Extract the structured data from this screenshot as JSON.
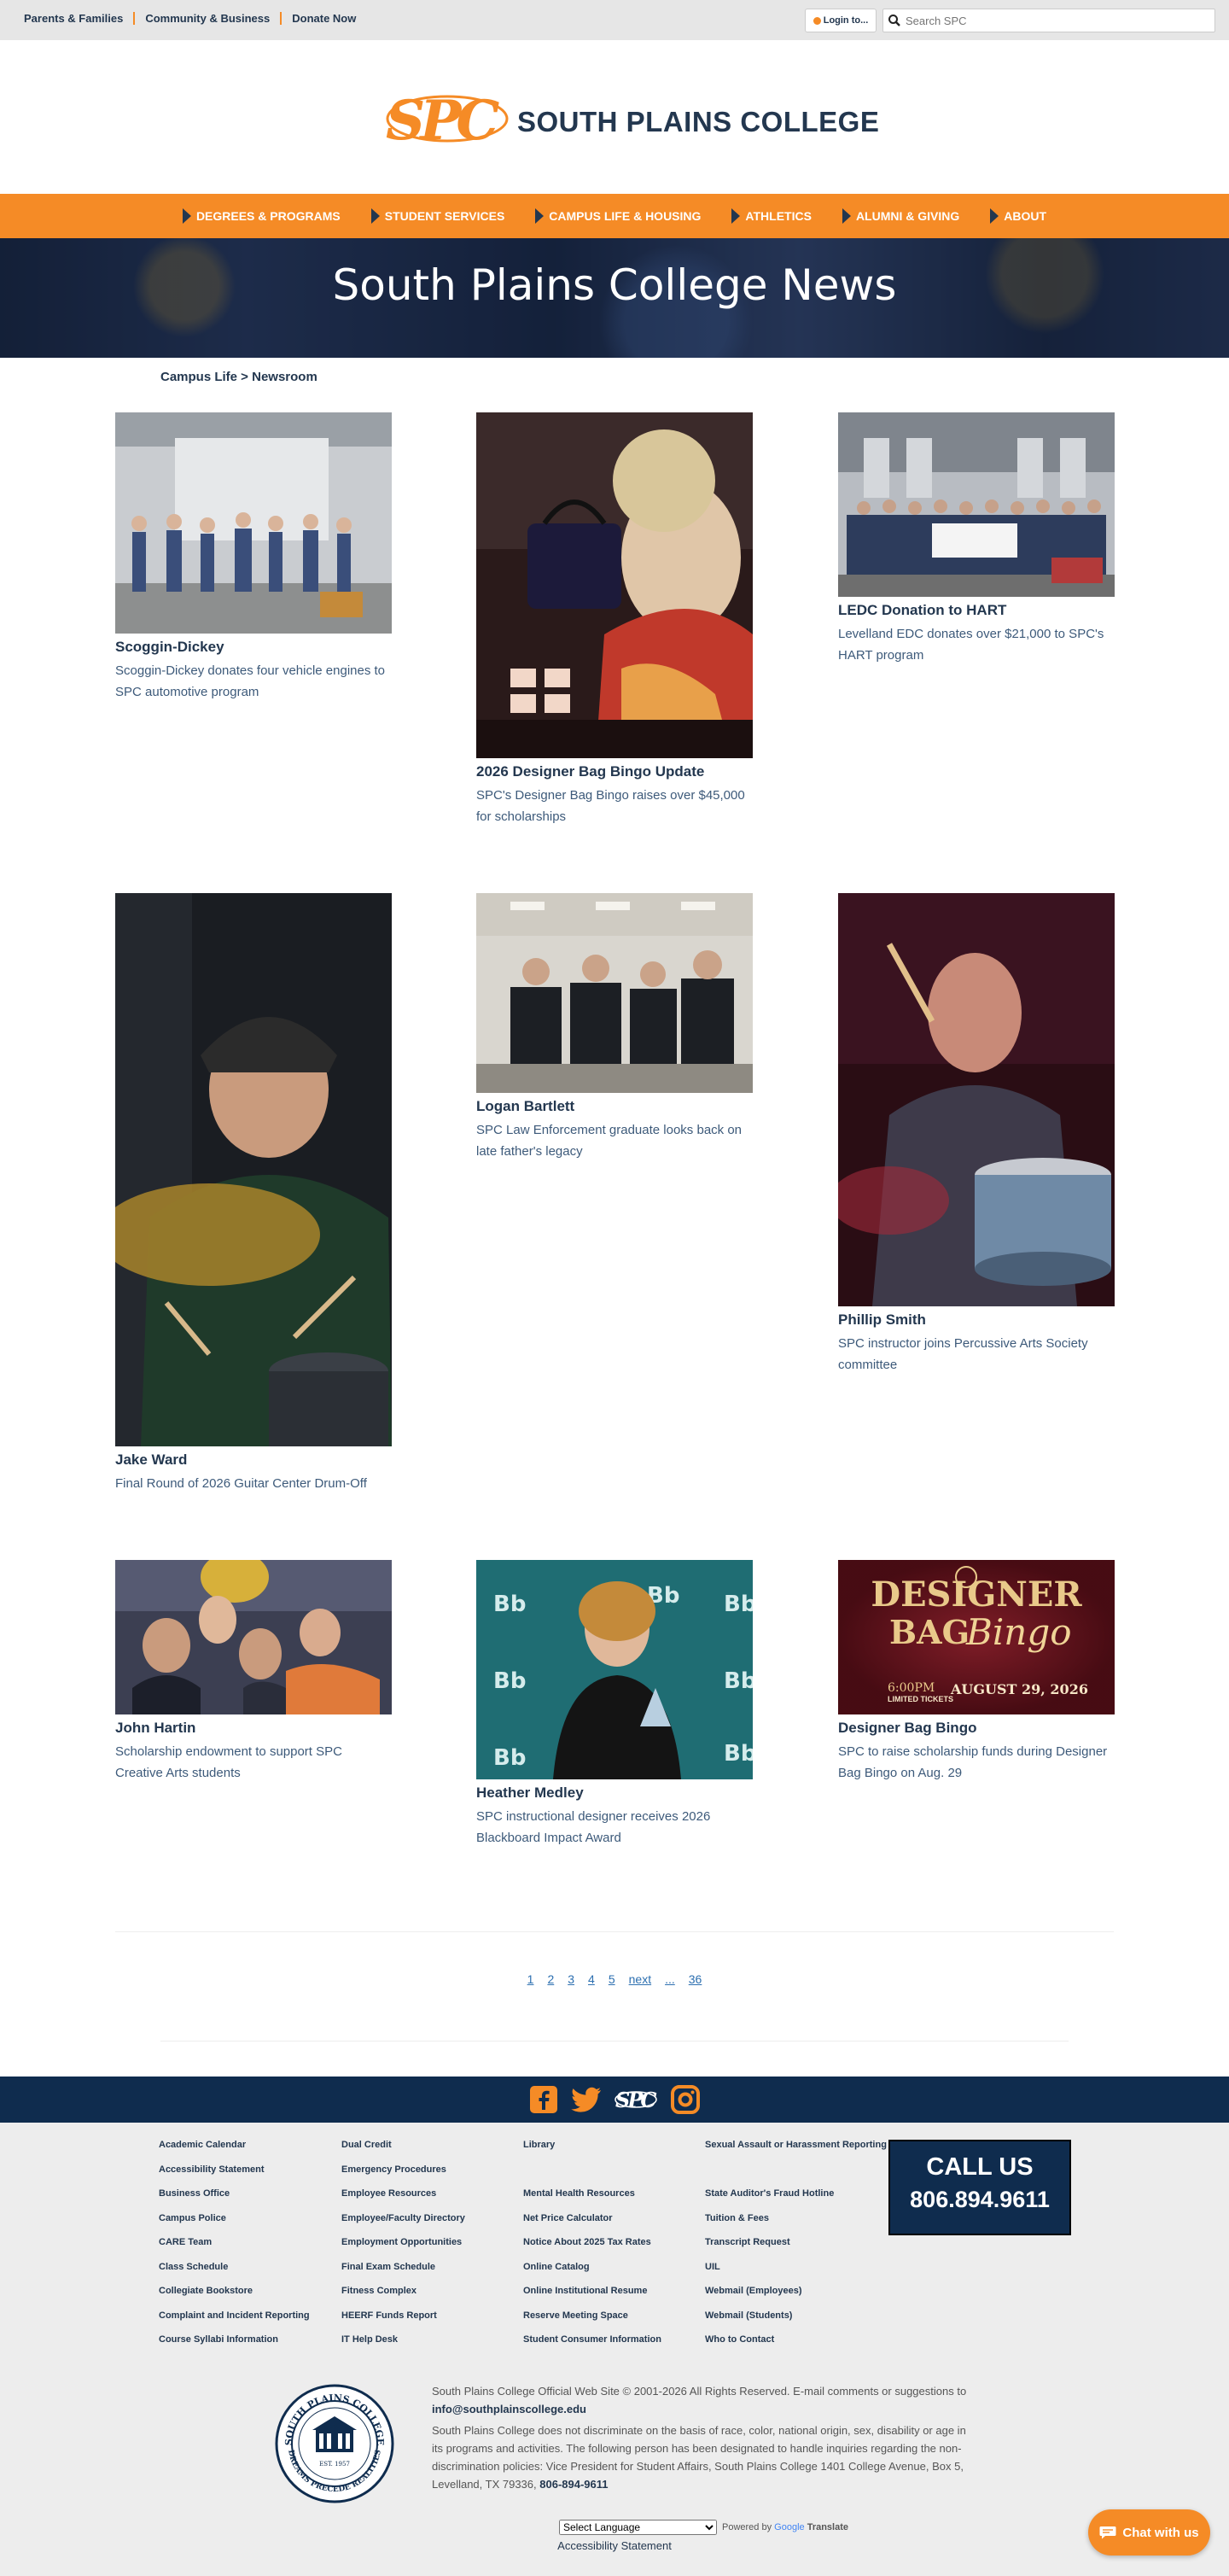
{
  "utility": {
    "links": [
      "Parents & Families",
      "Community & Business",
      "Donate Now"
    ],
    "login_label": "Login to...",
    "search_placeholder": "Search SPC"
  },
  "brand": {
    "logo_monogram": "SPC",
    "name": "SOUTH PLAINS COLLEGE",
    "primary_color": "#f58b26",
    "navy_color": "#23374f"
  },
  "nav": {
    "items": [
      "DEGREES & PROGRAMS",
      "STUDENT SERVICES",
      "CAMPUS LIFE & HOUSING",
      "ATHLETICS",
      "ALUMNI & GIVING",
      "ABOUT"
    ]
  },
  "hero": {
    "title": "South Plains College News"
  },
  "breadcrumb": "Campus Life > Newsroom",
  "news": [
    {
      "title": "Scoggin-Dickey",
      "desc": "Scoggin-Dickey donates four vehicle engines to SPC automotive program"
    },
    {
      "title": "2026 Designer Bag Bingo Update",
      "desc": "SPC's Designer Bag Bingo raises over $45,000 for scholarships"
    },
    {
      "title": "LEDC Donation to HART",
      "desc": "Levelland EDC donates over $21,000 to SPC's HART program"
    },
    {
      "title": "Jake Ward",
      "desc": "Final Round of 2026 Guitar Center Drum-Off"
    },
    {
      "title": "Logan Bartlett",
      "desc": "SPC Law Enforcement graduate looks back on late father's legacy"
    },
    {
      "title": "Phillip Smith",
      "desc": "SPC instructor joins Percussive Arts Society committee"
    },
    {
      "title": "John Hartin",
      "desc": "Scholarship endowment to support SPC Creative Arts students"
    },
    {
      "title": "Heather Medley",
      "desc": "SPC instructional designer receives 2026 Blackboard Impact Award"
    },
    {
      "title": "Designer Bag Bingo",
      "desc": "SPC to raise scholarship funds during Designer Bag Bingo on Aug. 29"
    }
  ],
  "bingo_banner": {
    "line1": "DESIGNER",
    "line2": "BAG",
    "line3": "Bingo",
    "time": "6:00PM",
    "date": "AUGUST 29, 2026",
    "limited": "LIMITED TICKETS"
  },
  "pagination": [
    "1",
    "2",
    "3",
    "4",
    "5",
    "next",
    "...",
    "36"
  ],
  "footer": {
    "col1": [
      "Academic Calendar",
      "Accessibility Statement",
      "Business Office",
      "Campus Police",
      "CARE Team",
      "Class Schedule",
      "Collegiate Bookstore",
      "Complaint and Incident Reporting",
      "Course Syllabi Information"
    ],
    "col2": [
      "Dual Credit",
      "Emergency Procedures",
      "Employee Resources",
      "Employee/Faculty Directory",
      "Employment Opportunities",
      "Final Exam Schedule",
      "Fitness Complex",
      "HEERF Funds Report",
      "IT Help Desk"
    ],
    "col3": [
      "Library",
      "",
      "Mental Health Resources",
      "Net Price Calculator",
      "Notice About 2025 Tax Rates",
      "Online Catalog",
      "Online Institutional Resume",
      "Reserve Meeting Space",
      "Student Consumer Information"
    ],
    "col4": [
      "Sexual Assault or Harassment Reporting",
      "",
      "State Auditor's Fraud Hotline",
      "Tuition & Fees",
      "Transcript Request",
      "UIL",
      "Webmail (Employees)",
      "Webmail (Students)",
      "Who to Contact"
    ],
    "call_label": "CALL US",
    "call_number": "806.894.9611",
    "copyright": "South Plains College Official Web Site © 2001-2026 All Rights Reserved. E-mail comments or suggestions to",
    "email": "info@southplainscollege.edu",
    "nondiscrimination": "South Plains College does not discriminate on the basis of race, color, national origin, sex, disability or age in its programs and activities. The following person has been designated to handle inquiries regarding the non-discrimination policies: Vice President for Student Affairs, South Plains College 1401 College Avenue, Box 5, Levelland, TX 79336,",
    "phone": "806-894-9611",
    "translate_select": "Select Language",
    "powered_by": "Powered by",
    "google": "Google",
    "translate": "Translate",
    "accessibility": "Accessibility Statement",
    "seal_text_top": "SOUTH PLAINS COLLEGE",
    "seal_text_bottom": "DREAMS PRECEDE REALITIES",
    "seal_est": "EST. 1957"
  },
  "chat": {
    "label": "Chat with us"
  }
}
